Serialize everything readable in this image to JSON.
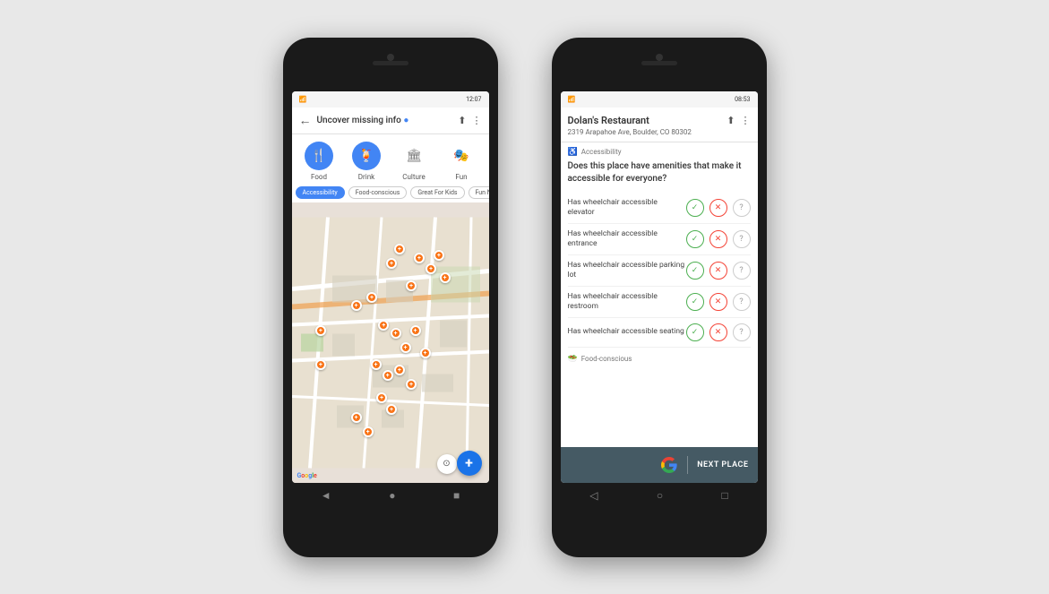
{
  "background": "#e8e8e8",
  "phone1": {
    "status_bar": {
      "time": "12:07",
      "icons": "signal wifi battery"
    },
    "toolbar": {
      "title": "Uncover missing info",
      "dot": "●",
      "back_icon": "←",
      "share_icon": "⬆",
      "more_icon": "⋮"
    },
    "categories": [
      {
        "label": "Food",
        "icon": "🍴",
        "active": true
      },
      {
        "label": "Drink",
        "icon": "🍹",
        "active": true
      },
      {
        "label": "Culture",
        "icon": "🏛",
        "active": false
      },
      {
        "label": "Fun",
        "icon": "🎭",
        "active": false
      }
    ],
    "filters": [
      {
        "label": "Accessibility",
        "active": true
      },
      {
        "label": "Food-conscious",
        "active": false
      },
      {
        "label": "Great For Kids",
        "active": false
      },
      {
        "label": "Fun Night C...",
        "active": false
      }
    ],
    "map": {
      "google_logo": [
        "G",
        "o",
        "o",
        "g",
        "l",
        "e"
      ]
    },
    "nav": [
      "◄",
      "●",
      "■"
    ]
  },
  "phone2": {
    "status_bar": {
      "time": "08:53"
    },
    "place": {
      "name": "Dolan's Restaurant",
      "address": "2319 Arapahoe Ave, Boulder, CO 80302",
      "share_icon": "⬆",
      "more_icon": "⋮"
    },
    "accessibility_tag": "Accessibility",
    "question": "Does this place have amenities that make it accessible for everyone?",
    "amenities": [
      {
        "label": "Has wheelchair accessible elevator"
      },
      {
        "label": "Has wheelchair accessible entrance"
      },
      {
        "label": "Has wheelchair accessible parking lot"
      },
      {
        "label": "Has wheelchair accessible restroom"
      },
      {
        "label": "Has wheelchair accessible seating"
      }
    ],
    "food_conscious_tag": "Food-conscious",
    "next_place_label": "NEXT PLACE",
    "nav": [
      "◁",
      "○",
      "□"
    ]
  }
}
